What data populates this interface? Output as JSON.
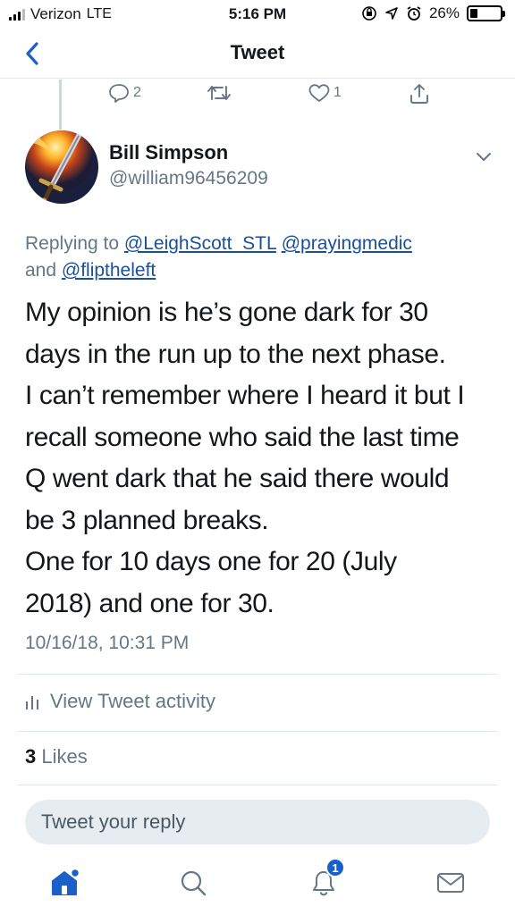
{
  "status_bar": {
    "carrier": "Verizon",
    "network": "LTE",
    "time": "5:16 PM",
    "battery": "26%",
    "battery_level": 0.26
  },
  "nav": {
    "back_icon": "chevron-left-icon",
    "title": "Tweet"
  },
  "parent_actions": {
    "reply_count": "2",
    "retweet_count": "",
    "like_count": "1"
  },
  "author": {
    "name": "Bill Simpson",
    "handle": "@william96456209"
  },
  "reply_context": {
    "prefix": "Replying to ",
    "mention1": "@LeighScott_STL",
    "mention2": "@prayingmedic",
    "conjunction": "and ",
    "mention3": "@fliptheleft"
  },
  "tweet": {
    "text": "My opinion is he’s gone dark for 30\ndays in the run up to the next phase.\nI can’t remember where I heard it but I\nrecall someone who said the last time\nQ went dark that he said there would\nbe 3 planned breaks.\nOne for 10 days one for 20 (July\n2018) and one for 30.",
    "timestamp": "10/16/18, 10:31 PM"
  },
  "activity": {
    "label": "View Tweet activity"
  },
  "likes": {
    "count": "3",
    "label": "Likes"
  },
  "reply_box": {
    "placeholder": "Tweet your reply"
  },
  "tab_bar": {
    "notifications_badge": "1"
  },
  "colors": {
    "accent": "#1b60c8",
    "link": "#1b4f9b",
    "muted": "#657786",
    "divider": "#e1e8ed"
  }
}
